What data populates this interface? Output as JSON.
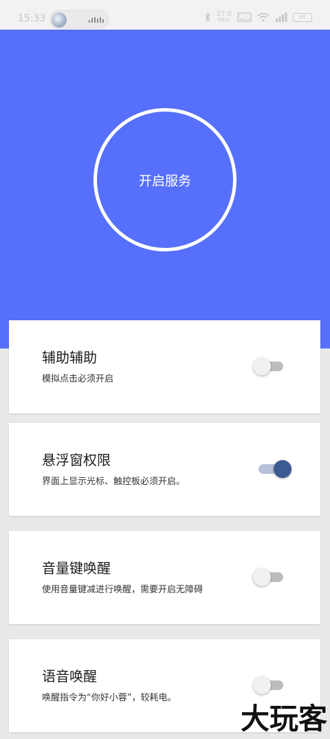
{
  "status_bar": {
    "time": "15:33",
    "net_speed_value": "27.0",
    "net_speed_unit": "KB/S",
    "hd_label": "HD",
    "battery_label": "60"
  },
  "hero": {
    "background_color": "#5770fb",
    "service_button_label": "开启服务"
  },
  "cards": [
    {
      "title": "辅助辅助",
      "description": "模拟点击必须开启",
      "enabled": false
    },
    {
      "title": "悬浮窗权限",
      "description": "界面上显示光标、触控板必须开启。",
      "enabled": true
    },
    {
      "title": "音量键唤醒",
      "description": "使用音量键减进行唤醒，需要开启无障碍",
      "enabled": false
    },
    {
      "title": "语音唤醒",
      "description": "唤醒指令为“你好小蓉”，较耗电。",
      "enabled": false
    }
  ],
  "colors": {
    "toggle_on_thumb": "#3c5a92",
    "toggle_on_track": "#b6c0d8",
    "toggle_off_thumb": "#f1f1f1",
    "toggle_off_track": "#bdbdbd",
    "page_background": "#e9e9e9"
  },
  "watermark": "大玩客"
}
